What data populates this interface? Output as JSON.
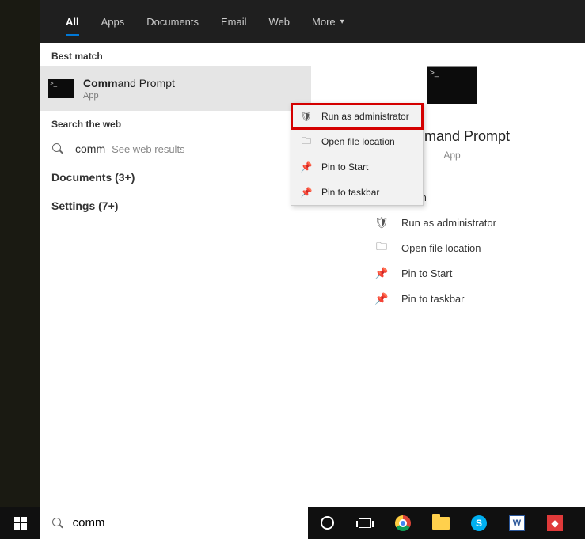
{
  "tabs": [
    "All",
    "Apps",
    "Documents",
    "Email",
    "Web",
    "More"
  ],
  "active_tab": 0,
  "sections": {
    "best_match": "Best match",
    "search_web": "Search the web",
    "documents": "Documents (3+)",
    "settings": "Settings (7+)"
  },
  "best_match_item": {
    "title_prefix": "Comm",
    "title_suffix": "and Prompt",
    "sub": "App"
  },
  "web_result": {
    "query": "comm",
    "sub": " - See web results"
  },
  "detail": {
    "title": "Command Prompt",
    "sub": "App"
  },
  "actions": {
    "open": "Open",
    "run_admin": "Run as administrator",
    "open_loc": "Open file location",
    "pin_start": "Pin to Start",
    "pin_taskbar": "Pin to taskbar"
  },
  "context_menu": {
    "run_admin": "Run as administrator",
    "open_loc": "Open file location",
    "pin_start": "Pin to Start",
    "pin_taskbar": "Pin to taskbar"
  },
  "search_input": "comm"
}
